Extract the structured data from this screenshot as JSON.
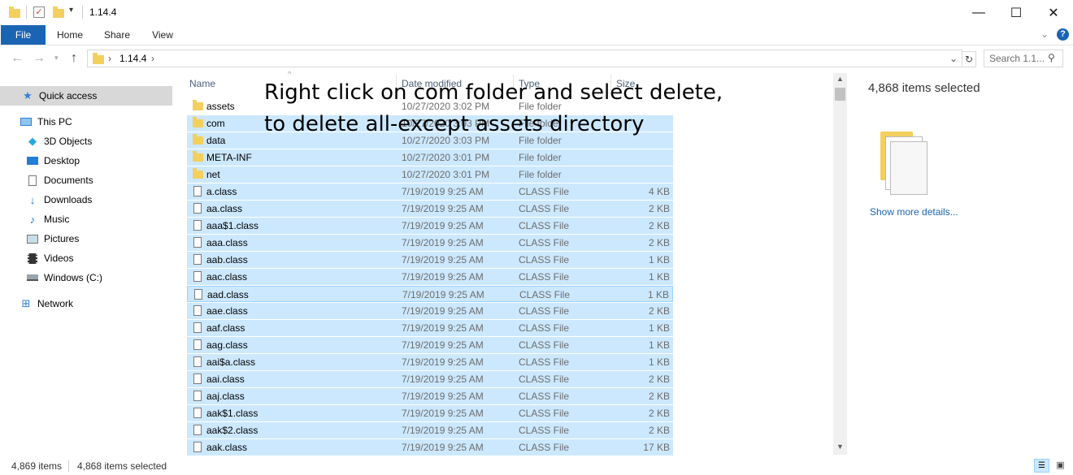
{
  "window": {
    "title": "1.14.4",
    "controls": {
      "minimize": "—",
      "maximize": "☐",
      "close": "✕"
    }
  },
  "ribbon": {
    "tabs": [
      "File",
      "Home",
      "Share",
      "View"
    ]
  },
  "address": {
    "path": "1.14.4",
    "search_placeholder": "Search 1.1..."
  },
  "nav": {
    "items": [
      {
        "label": "Quick access",
        "icon": "star-icon",
        "selected": true
      },
      {
        "label": "This PC",
        "icon": "computer-icon"
      },
      {
        "label": "3D Objects",
        "icon": "cube-icon"
      },
      {
        "label": "Desktop",
        "icon": "desktop-icon"
      },
      {
        "label": "Documents",
        "icon": "document-icon"
      },
      {
        "label": "Downloads",
        "icon": "download-icon"
      },
      {
        "label": "Music",
        "icon": "music-icon"
      },
      {
        "label": "Pictures",
        "icon": "picture-icon"
      },
      {
        "label": "Videos",
        "icon": "video-icon"
      },
      {
        "label": "Windows (C:)",
        "icon": "drive-icon"
      },
      {
        "label": "Network",
        "icon": "network-icon"
      }
    ]
  },
  "columns": {
    "name": "Name",
    "date": "Date modified",
    "type": "Type",
    "size": "Size"
  },
  "files": [
    {
      "name": "assets",
      "date": "10/27/2020 3:02 PM",
      "type": "File folder",
      "size": "",
      "kind": "folder",
      "selected": false
    },
    {
      "name": "com",
      "date": "10/27/2020 3:03 PM",
      "type": "File folder",
      "size": "",
      "kind": "folder",
      "selected": true
    },
    {
      "name": "data",
      "date": "10/27/2020 3:03 PM",
      "type": "File folder",
      "size": "",
      "kind": "folder",
      "selected": true
    },
    {
      "name": "META-INF",
      "date": "10/27/2020 3:01 PM",
      "type": "File folder",
      "size": "",
      "kind": "folder",
      "selected": true
    },
    {
      "name": "net",
      "date": "10/27/2020 3:01 PM",
      "type": "File folder",
      "size": "",
      "kind": "folder",
      "selected": true
    },
    {
      "name": "a.class",
      "date": "7/19/2019 9:25 AM",
      "type": "CLASS File",
      "size": "4 KB",
      "kind": "file",
      "selected": true
    },
    {
      "name": "aa.class",
      "date": "7/19/2019 9:25 AM",
      "type": "CLASS File",
      "size": "2 KB",
      "kind": "file",
      "selected": true
    },
    {
      "name": "aaa$1.class",
      "date": "7/19/2019 9:25 AM",
      "type": "CLASS File",
      "size": "2 KB",
      "kind": "file",
      "selected": true
    },
    {
      "name": "aaa.class",
      "date": "7/19/2019 9:25 AM",
      "type": "CLASS File",
      "size": "2 KB",
      "kind": "file",
      "selected": true
    },
    {
      "name": "aab.class",
      "date": "7/19/2019 9:25 AM",
      "type": "CLASS File",
      "size": "1 KB",
      "kind": "file",
      "selected": true
    },
    {
      "name": "aac.class",
      "date": "7/19/2019 9:25 AM",
      "type": "CLASS File",
      "size": "1 KB",
      "kind": "file",
      "selected": true
    },
    {
      "name": "aad.class",
      "date": "7/19/2019 9:25 AM",
      "type": "CLASS File",
      "size": "1 KB",
      "kind": "file",
      "selected": true,
      "focus": true
    },
    {
      "name": "aae.class",
      "date": "7/19/2019 9:25 AM",
      "type": "CLASS File",
      "size": "2 KB",
      "kind": "file",
      "selected": true
    },
    {
      "name": "aaf.class",
      "date": "7/19/2019 9:25 AM",
      "type": "CLASS File",
      "size": "1 KB",
      "kind": "file",
      "selected": true
    },
    {
      "name": "aag.class",
      "date": "7/19/2019 9:25 AM",
      "type": "CLASS File",
      "size": "1 KB",
      "kind": "file",
      "selected": true
    },
    {
      "name": "aai$a.class",
      "date": "7/19/2019 9:25 AM",
      "type": "CLASS File",
      "size": "1 KB",
      "kind": "file",
      "selected": true
    },
    {
      "name": "aai.class",
      "date": "7/19/2019 9:25 AM",
      "type": "CLASS File",
      "size": "2 KB",
      "kind": "file",
      "selected": true
    },
    {
      "name": "aaj.class",
      "date": "7/19/2019 9:25 AM",
      "type": "CLASS File",
      "size": "2 KB",
      "kind": "file",
      "selected": true
    },
    {
      "name": "aak$1.class",
      "date": "7/19/2019 9:25 AM",
      "type": "CLASS File",
      "size": "2 KB",
      "kind": "file",
      "selected": true
    },
    {
      "name": "aak$2.class",
      "date": "7/19/2019 9:25 AM",
      "type": "CLASS File",
      "size": "2 KB",
      "kind": "file",
      "selected": true
    },
    {
      "name": "aak.class",
      "date": "7/19/2019 9:25 AM",
      "type": "CLASS File",
      "size": "17 KB",
      "kind": "file",
      "selected": true
    }
  ],
  "annotation": {
    "line1": "Right click on com folder and select delete,",
    "line2": "to delete all-except assets directory"
  },
  "details": {
    "count": "4,868 items selected",
    "link": "Show more details..."
  },
  "status": {
    "items": "4,869 items",
    "selected": "4,868 items selected"
  },
  "colors": {
    "accent": "#1a64b4",
    "selection": "#cce8ff",
    "selection_border": "#99d1ff",
    "folder": "#f3cf5e"
  }
}
